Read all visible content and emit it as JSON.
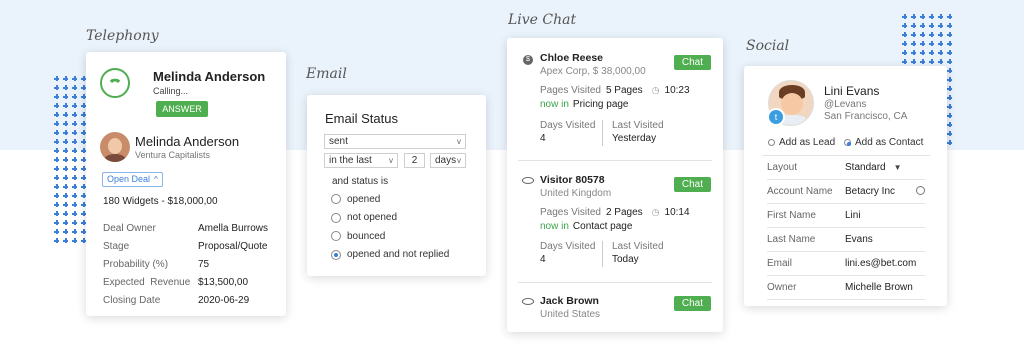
{
  "sections": {
    "telephony": "Telephony",
    "email": "Email",
    "live_chat": "Live Chat",
    "social": "Social"
  },
  "telephony": {
    "caller_name": "Melinda Anderson",
    "status": "Calling...",
    "answer_label": "ANSWER",
    "contact_name": "Melinda Anderson",
    "company": "Ventura Capitalists",
    "open_deal_label": "Open Deal",
    "deal_title": "180 Widgets - $18,000,00",
    "fields": [
      {
        "label": "Deal Owner",
        "value": "Amella Burrows"
      },
      {
        "label": "Stage",
        "value": "Proposal/Quote"
      },
      {
        "label": "Probability (%)",
        "value": "75"
      },
      {
        "label": "Expected  Revenue",
        "value": "$13,500,00"
      },
      {
        "label": "Closing Date",
        "value": "2020-06-29"
      }
    ]
  },
  "email": {
    "title": "Email Status",
    "status_select": "sent",
    "period_select": "in the last",
    "count_value": "2",
    "unit_select": "days",
    "and_status_label": "and status is",
    "options": [
      {
        "label": "opened",
        "selected": false
      },
      {
        "label": "not opened",
        "selected": false
      },
      {
        "label": "bounced",
        "selected": false
      },
      {
        "label": "opened and not replied",
        "selected": true
      }
    ]
  },
  "live_chat": {
    "chat_label": "Chat",
    "visitors": [
      {
        "name": "Chloe Reese",
        "sub": "Apex Corp, $ 38,000,00",
        "pages_visited_label": "Pages Visited",
        "pages_visited": "5 Pages",
        "time": "10:23",
        "now_in_label": "now in",
        "now_in_page": "Pricing page",
        "days_visited_label": "Days Visited",
        "days_visited": "4",
        "last_visited_label": "Last Visited",
        "last_visited": "Yesterday"
      },
      {
        "name": "Visitor 80578",
        "sub": "United Kingdom",
        "pages_visited_label": "Pages Visited",
        "pages_visited": "2 Pages",
        "time": "10:14",
        "now_in_label": "now in",
        "now_in_page": "Contact page",
        "days_visited_label": "Days Visited",
        "days_visited": "4",
        "last_visited_label": "Last Visited",
        "last_visited": "Today"
      },
      {
        "name": "Jack Brown",
        "sub": "United States"
      }
    ]
  },
  "social": {
    "name": "Lini Evans",
    "handle": "@Levans",
    "location": "San Francisco, CA",
    "add_lead_label": "Add as Lead",
    "add_contact_label": "Add as Contact",
    "fields": [
      {
        "label": "Layout",
        "value": "Standard"
      },
      {
        "label": "Account Name",
        "value": "Betacry Inc"
      },
      {
        "label": "First Name",
        "value": "Lini"
      },
      {
        "label": "Last Name",
        "value": "Evans"
      },
      {
        "label": "Email",
        "value": "lini.es@bet.com"
      },
      {
        "label": "Owner",
        "value": "Michelle Brown"
      }
    ]
  },
  "colors": {
    "accent": "#3b7fd9",
    "green": "#4fae4f",
    "band": "#eaf2fb"
  }
}
